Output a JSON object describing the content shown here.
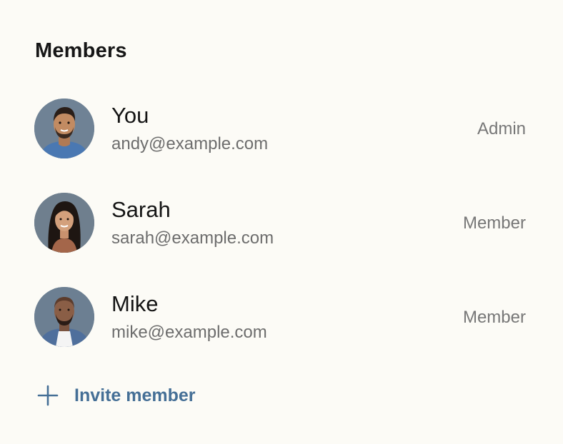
{
  "header": {
    "title": "Members"
  },
  "members": [
    {
      "name": "You",
      "email": "andy@example.com",
      "role": "Admin",
      "avatar": "avatar-man-beard"
    },
    {
      "name": "Sarah",
      "email": "sarah@example.com",
      "role": "Member",
      "avatar": "avatar-woman-long-hair"
    },
    {
      "name": "Mike",
      "email": "mike@example.com",
      "role": "Member",
      "avatar": "avatar-man-bald"
    }
  ],
  "invite": {
    "label": "Invite member",
    "icon": "plus-icon"
  },
  "colors": {
    "background": "#fcfbf6",
    "accent": "#456f96",
    "secondary_text": "#6d6d6d",
    "avatar_background": "#6f8295"
  }
}
